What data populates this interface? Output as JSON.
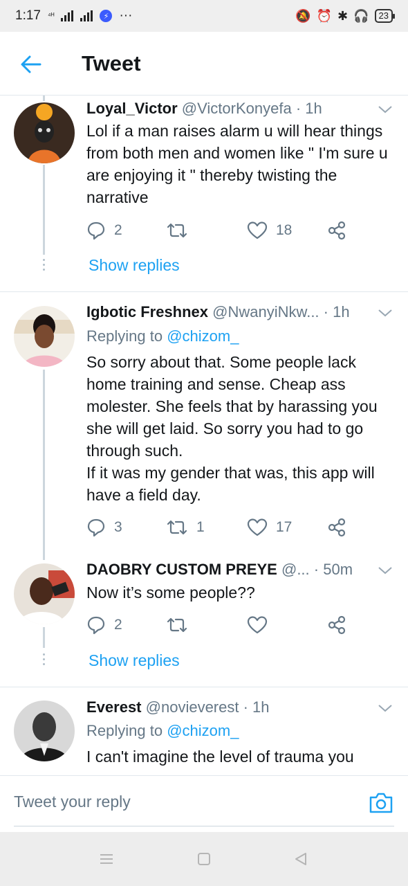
{
  "status_bar": {
    "time": "1:17",
    "network": "⁴ᴴ",
    "battery": "23",
    "more": "···"
  },
  "header": {
    "title": "Tweet"
  },
  "tweets": [
    {
      "name": "Loyal_Victor",
      "handle": "@VictorKonyefa",
      "time": "· 1h",
      "body": "Lol if a man raises alarm u will hear things from both men and women like \" I'm sure u are enjoying it \" thereby twisting the narrative",
      "replies": "2",
      "retweets": "",
      "likes": "18",
      "show_replies": "Show replies"
    },
    {
      "name": "Igbotic Freshnex",
      "handle": "@NwanyiNkw...",
      "time": "· 1h",
      "replying_prefix": "Replying to ",
      "replying_to": "@chizom_",
      "body": "So sorry about that. Some people lack home training and sense. Cheap ass molester. She feels that by harassing you she will get laid. So sorry you had to go through such.\nIf it was my gender that was, this app will have a field day.",
      "replies": "3",
      "retweets": "1",
      "likes": "17"
    },
    {
      "name": "DAOBRY CUSTOM PREYE",
      "handle": "@...",
      "time": "· 50m",
      "body": "Now it’s some people??",
      "replies": "2",
      "retweets": "",
      "likes": "",
      "show_replies": "Show replies"
    },
    {
      "name": "Everest",
      "handle": "@novieverest",
      "time": "· 1h",
      "replying_prefix": "Replying to ",
      "replying_to": "@chizom_",
      "body": "I can't imagine the level of trauma you"
    }
  ],
  "reply_bar": {
    "placeholder": "Tweet your reply"
  },
  "colors": {
    "accent": "#1da1f2",
    "secondary_text": "#657786",
    "divider": "#e1e8ed"
  }
}
